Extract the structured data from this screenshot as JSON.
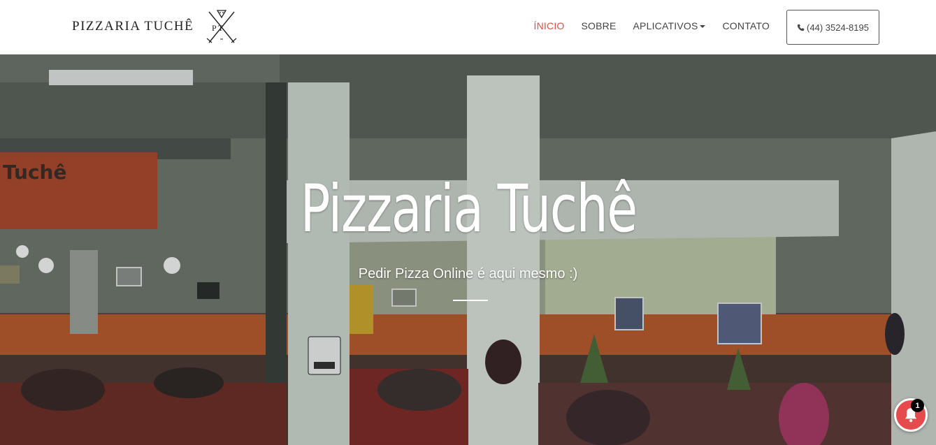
{
  "brand": {
    "name": "PIZZARIA TUCHÊ",
    "logo_letters": "P T",
    "icon": "crossed-swords-pizza-logo"
  },
  "nav": {
    "items": [
      {
        "label": "ÍNICIO",
        "active": true
      },
      {
        "label": "SOBRE",
        "active": false
      },
      {
        "label": "APLICATIVOS",
        "active": false,
        "dropdown": true
      },
      {
        "label": "CONTATO",
        "active": false
      }
    ],
    "phone": {
      "label": "(44) 3524-8195",
      "icon": "phone-icon"
    }
  },
  "hero": {
    "title": "Pizzaria Tuchê",
    "subtitle": "Pedir Pizza Online é aqui mesmo :)",
    "background": "restaurant-dining-room-photo"
  },
  "notification": {
    "icon": "bell-icon",
    "count": "1"
  },
  "colors": {
    "accent": "#e74c3c",
    "notification": "#e54b4d"
  }
}
